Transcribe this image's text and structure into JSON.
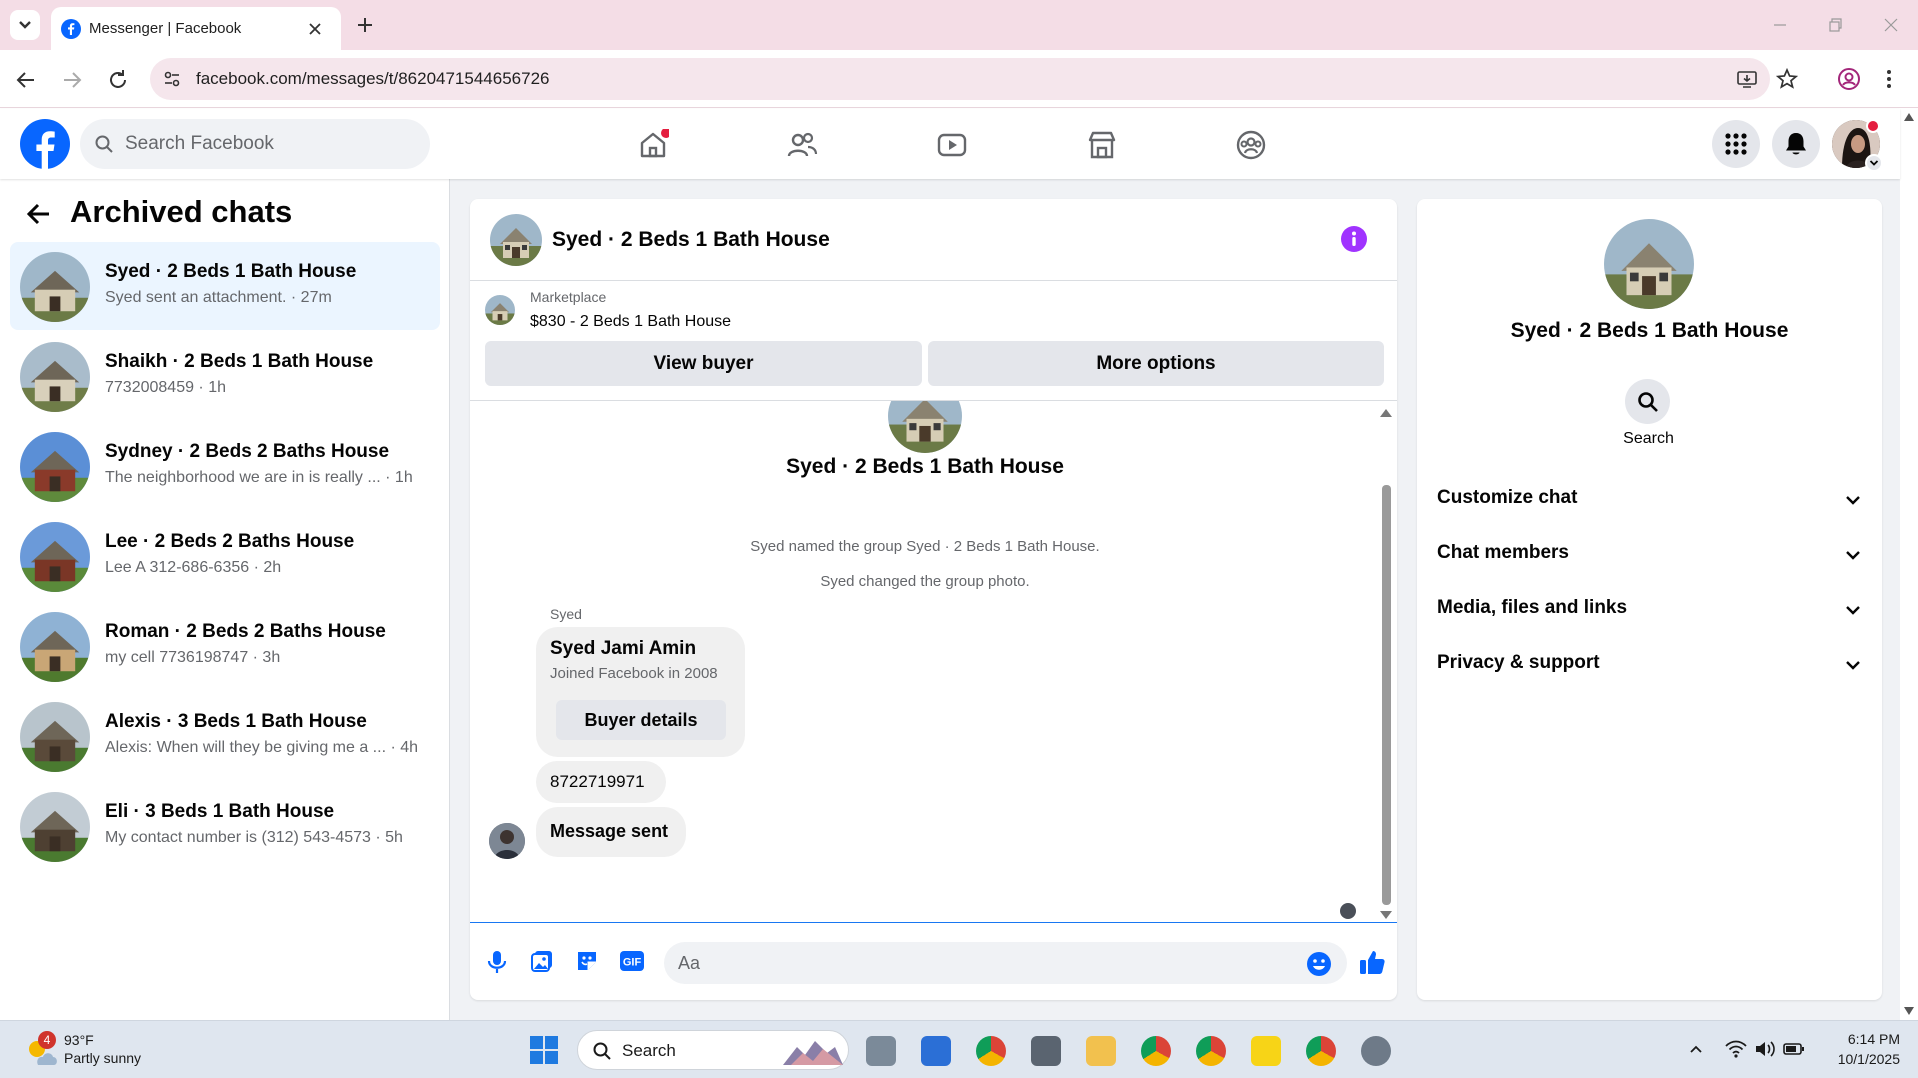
{
  "browser": {
    "tab_title": "Messenger | Facebook",
    "url": "facebook.com/messages/t/8620471544656726"
  },
  "fb": {
    "search_placeholder": "Search Facebook"
  },
  "sidebar": {
    "title": "Archived chats",
    "conversations": [
      {
        "name": "Syed · 2 Beds 1 Bath House",
        "preview": "Syed sent an attachment. · 27m",
        "active": true
      },
      {
        "name": "Shaikh · 2 Beds 1 Bath House",
        "preview": "7732008459 · 1h"
      },
      {
        "name": "Sydney · 2 Beds 2 Baths House",
        "preview": "The neighborhood we are in is really ... · 1h"
      },
      {
        "name": "Lee · 2 Beds 2 Baths House",
        "preview": "Lee A 312-686-6356 · 2h"
      },
      {
        "name": "Roman · 2 Beds 2 Baths House",
        "preview": "my cell 7736198747 · 3h"
      },
      {
        "name": "Alexis · 3 Beds 1 Bath House",
        "preview": "Alexis: When will they be giving me a ... · 4h"
      },
      {
        "name": "Eli · 3 Beds 1 Bath House",
        "preview": "My contact number is (312) 543-4573 · 5h"
      }
    ]
  },
  "chat": {
    "title": "Syed · 2 Beds 1 Bath House",
    "marketplace_label": "Marketplace",
    "listing": "$830 - 2 Beds 1 Bath House",
    "view_buyer": "View buyer",
    "more_options": "More options",
    "header_name": "Syed · 2 Beds 1 Bath House",
    "system_messages": [
      "Syed named the group Syed · 2 Beds 1 Bath House.",
      "Syed changed the group photo."
    ],
    "sender_label": "Syed",
    "card_name": "Syed Jami Amin",
    "card_sub": "Joined Facebook in 2008",
    "buyer_details": "Buyer details",
    "msg_phone": "8722719971",
    "msg_sent": "Message sent",
    "composer_placeholder": "Aa"
  },
  "info": {
    "name": "Syed · 2 Beds 1 Bath House",
    "search_label": "Search",
    "sections": [
      "Customize chat",
      "Chat members",
      "Media, files and links",
      "Privacy & support"
    ]
  },
  "taskbar": {
    "weather_temp": "93°F",
    "weather_desc": "Partly sunny",
    "weather_badge": "4",
    "search_label": "Search",
    "time": "6:14 PM",
    "date": "10/1/2025"
  },
  "colors": {
    "fb_blue": "#0866ff",
    "messenger_purple": "#a033ff",
    "tab_bar": "#f4dde6"
  }
}
